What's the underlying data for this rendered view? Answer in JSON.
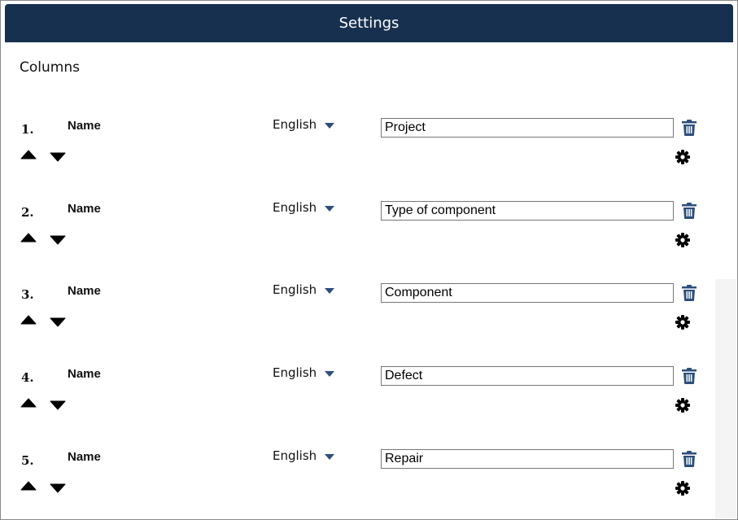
{
  "dialog": {
    "title": "Settings"
  },
  "section": {
    "title": "Columns"
  },
  "columns": [
    {
      "number": "1.",
      "label": "Name",
      "language": "English",
      "value": "Project"
    },
    {
      "number": "2.",
      "label": "Name",
      "language": "English",
      "value": "Type of component"
    },
    {
      "number": "3.",
      "label": "Name",
      "language": "English",
      "value": "Component"
    },
    {
      "number": "4.",
      "label": "Name",
      "language": "English",
      "value": "Defect"
    },
    {
      "number": "5.",
      "label": "Name",
      "language": "English",
      "value": "Repair"
    }
  ],
  "icons": {
    "delete": "trash-icon",
    "settings": "gear-icon",
    "move_up": "caret-up-icon",
    "move_down": "caret-down-icon",
    "language_dropdown": "caret-down-icon"
  },
  "colors": {
    "header_bg": "#17304f",
    "header_text": "#ffffff",
    "trash": "#2d4e7a",
    "dropdown_caret": "#2d4e7a"
  }
}
